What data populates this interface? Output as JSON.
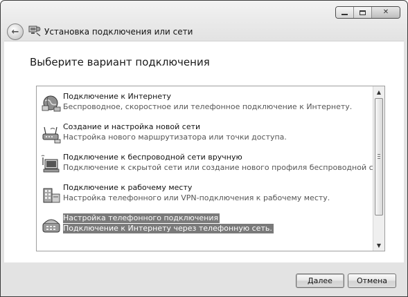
{
  "window": {
    "title": "Установка подключения или сети",
    "controls": {
      "minimize": "minimize",
      "maximize": "maximize",
      "close": "✕"
    }
  },
  "page": {
    "heading": "Выберите вариант подключения"
  },
  "options": [
    {
      "title": "Подключение к Интернету",
      "description": "Беспроводное, скоростное или телефонное подключение к Интернету.",
      "icon": "globe-network-icon",
      "selected": false
    },
    {
      "title": "Создание и настройка новой сети",
      "description": "Настройка нового маршрутизатора или точки доступа.",
      "icon": "router-icon",
      "selected": false
    },
    {
      "title": "Подключение к беспроводной сети вручную",
      "description": "Подключение к скрытой сети или создание нового профиля беспроводной связи.",
      "icon": "wireless-computer-icon",
      "selected": false
    },
    {
      "title": "Подключение к рабочему месту",
      "description": "Настройка телефонного или VPN-подключения к рабочему месту.",
      "icon": "workplace-building-icon",
      "selected": false
    },
    {
      "title": "Настройка телефонного подключения",
      "description": "Подключение к Интернету через телефонную сеть.",
      "icon": "dialup-phone-icon",
      "selected": true
    }
  ],
  "buttons": {
    "next": "Далее",
    "cancel": "Отмена"
  },
  "colors": {
    "selection": "#7a7a7a",
    "chrome": "#e3e3e3",
    "content": "#ffffff"
  }
}
